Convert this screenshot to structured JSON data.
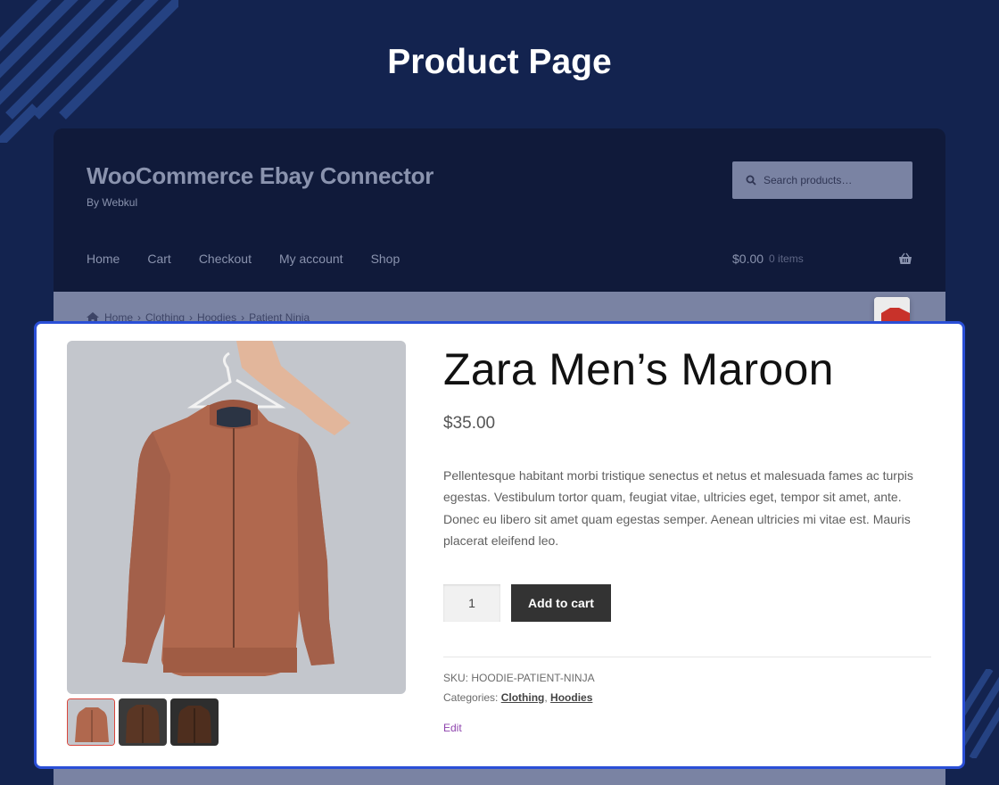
{
  "hero": {
    "title": "Product Page"
  },
  "store": {
    "title": "WooCommerce Ebay Connector",
    "tagline": "By Webkul",
    "search": {
      "placeholder": "Search products…"
    },
    "nav": [
      "Home",
      "Cart",
      "Checkout",
      "My account",
      "Shop"
    ],
    "cart": {
      "amount": "$0.00",
      "count": "0 items"
    }
  },
  "breadcrumb": [
    "Home",
    "Clothing",
    "Hoodies",
    "Patient Ninja"
  ],
  "product": {
    "title": "Zara Men’s Maroon",
    "price": "$35.00",
    "description": "Pellentesque habitant morbi tristique senectus et netus et malesuada fames ac turpis egestas. Vestibulum tortor quam, feugiat vitae, ultricies eget, tempor sit amet, ante. Donec eu libero sit amet quam egestas semper. Aenean ultricies mi vitae est. Mauris placerat eleifend leo.",
    "quantity": "1",
    "add_to_cart": "Add to cart",
    "sku_label": "SKU:",
    "sku": "HOODIE-PATIENT-NINJA",
    "categories_label": "Categories:",
    "categories": [
      "Clothing",
      "Hoodies"
    ],
    "edit": "Edit"
  },
  "colors": {
    "page_bg": "#13234f",
    "highlight_border": "#2a4fd7",
    "button_bg": "#333333",
    "edit_link": "#8e44ad",
    "jacket": "#b06a50"
  },
  "icons": [
    "search-icon",
    "basket-icon",
    "home-icon"
  ]
}
